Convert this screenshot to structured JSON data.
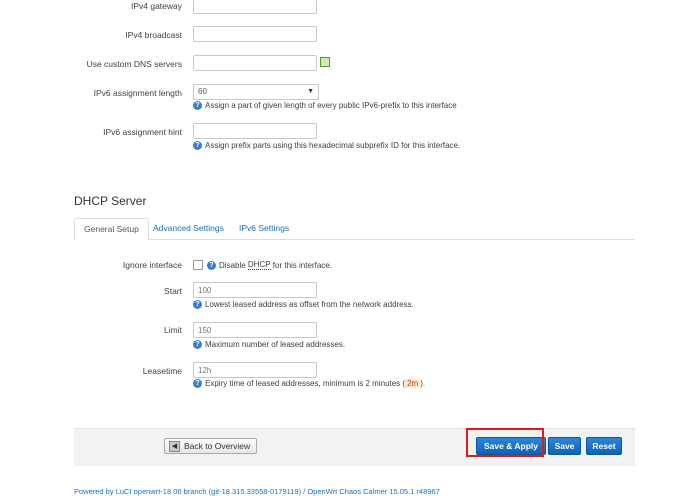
{
  "lan": {
    "ipv4_gateway": {
      "label": "IPv4 gateway",
      "value": ""
    },
    "ipv4_broadcast": {
      "label": "IPv4 broadcast",
      "value": ""
    },
    "custom_dns": {
      "label": "Use custom DNS servers",
      "value": ""
    },
    "ipv6_assignment_length": {
      "label": "IPv6 assignment length",
      "value": "60",
      "help": "Assign a part of given length of every public IPv6-prefix to this interface"
    },
    "ipv6_assignment_hint": {
      "label": "IPv6 assignment hint",
      "value": "",
      "help": "Assign prefix parts using this hexadecimal subprefix ID for this interface."
    }
  },
  "dhcp": {
    "title": "DHCP Server",
    "tabs": [
      "General Setup",
      "Advanced Settings",
      "IPv6 Settings"
    ],
    "ignore_interface": {
      "label": "Ignore interface",
      "help_prefix": "Disable ",
      "help_abbr": "DHCP",
      "help_suffix": " for this interface.",
      "checked": false
    },
    "start": {
      "label": "Start",
      "placeholder": "100",
      "help": "Lowest leased address as offset from the network address."
    },
    "limit": {
      "label": "Limit",
      "placeholder": "150",
      "help": "Maximum number of leased addresses."
    },
    "leasetime": {
      "label": "Leasetime",
      "placeholder": "12h",
      "help_prefix": "Expiry time of leased addresses, minimum is 2 minutes (",
      "help_code": "2m",
      "help_suffix": ")."
    }
  },
  "footer": {
    "back_button": "Back to Overview",
    "save_apply_button": "Save & Apply",
    "save_button": "Save",
    "reset_button": "Reset"
  },
  "powered_by": "Powered by LuCI openwrt-18.06 branch (git-18.315.33558-0179119) / OpenWrt Chaos Calmer 15.05.1 r48967",
  "icons": {
    "info": "info-icon",
    "dns_add": "add-dns-icon",
    "back": "back-arrow-icon"
  },
  "colors": {
    "accent": "#1d6fb8",
    "primary_button": "#1666c0",
    "highlight": "#e0191f"
  }
}
